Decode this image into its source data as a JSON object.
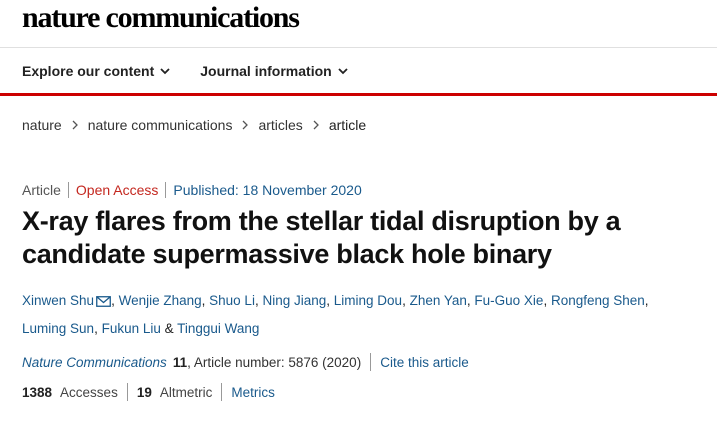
{
  "header": {
    "logo": "nature communications"
  },
  "nav": {
    "items": [
      {
        "label": "Explore our content"
      },
      {
        "label": "Journal information"
      }
    ]
  },
  "breadcrumb": {
    "items": [
      "nature",
      "nature communications",
      "articles",
      "article"
    ]
  },
  "article": {
    "type": "Article",
    "access": "Open Access",
    "published": "Published: 18 November 2020",
    "title": "X-ray flares from the stellar tidal disruption by a candidate supermassive black hole binary",
    "authors": [
      "Xinwen Shu",
      "Wenjie Zhang",
      "Shuo Li",
      "Ning Jiang",
      "Liming Dou",
      "Zhen Yan",
      "Fu-Guo Xie",
      "Rongfeng Shen",
      "Luming Sun",
      "Fukun Liu",
      "Tinggui Wang"
    ],
    "author_separator": ", ",
    "author_last_separator": " & ",
    "citation": {
      "journal": "Nature Communications",
      "volume": "11",
      "rest": ", Article number: 5876 (2020)",
      "cite_label": "Cite this article"
    },
    "metrics": {
      "accesses_value": "1388",
      "accesses_label": "Accesses",
      "altmetric_value": "19",
      "altmetric_label": "Altmetric",
      "metrics_label": "Metrics"
    }
  },
  "icons": {
    "nav_chevron": "chevron-down-icon",
    "crumb_separator": "chevron-right-icon",
    "corresponding_author": "mail-icon"
  },
  "colors": {
    "accent_red": "#cc0000",
    "open_access": "#c4271f",
    "link": "#1a5a8c"
  }
}
